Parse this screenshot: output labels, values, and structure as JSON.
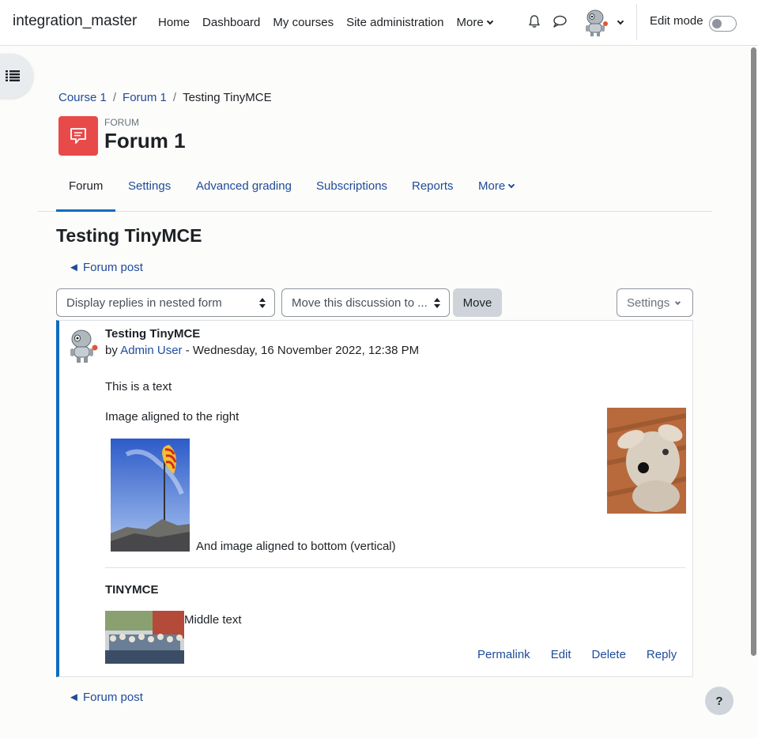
{
  "navbar": {
    "brand": "integration_master",
    "links": [
      "Home",
      "Dashboard",
      "My courses",
      "Site administration"
    ],
    "more_label": "More",
    "edit_mode_label": "Edit mode",
    "edit_mode_on": false
  },
  "breadcrumb": [
    "Course 1",
    "Forum 1",
    "Testing TinyMCE"
  ],
  "activity": {
    "type_label": "FORUM",
    "title": "Forum 1",
    "icon": "forum-icon",
    "icon_color": "#e84a4a"
  },
  "tabs": [
    {
      "label": "Forum",
      "active": true
    },
    {
      "label": "Settings",
      "active": false
    },
    {
      "label": "Advanced grading",
      "active": false
    },
    {
      "label": "Subscriptions",
      "active": false
    },
    {
      "label": "Reports",
      "active": false
    },
    {
      "label": "More",
      "active": false
    }
  ],
  "discussion": {
    "title": "Testing TinyMCE",
    "back_link_top": "◄ Forum post",
    "back_link_bottom": "◄ Forum post",
    "display_mode_selected": "Display replies in nested form",
    "move_select_selected": "Move this discussion to ...",
    "move_button": "Move",
    "settings_button": "Settings"
  },
  "post": {
    "subject": "Testing TinyMCE",
    "by_prefix": "by",
    "author": "Admin User",
    "date_suffix": "- Wednesday, 16 November 2022, 12:38 PM",
    "paragraph1": "This is a text",
    "paragraph2": "Image aligned to the right",
    "paragraph3": "And image aligned to bottom (vertical)",
    "heading": "TINYMCE",
    "middle_text": "Middle text",
    "actions": [
      "Permalink",
      "Edit",
      "Delete",
      "Reply"
    ]
  },
  "help_button": "?",
  "colors": {
    "accent": "#0f6cbf",
    "link": "#1f4b99"
  }
}
